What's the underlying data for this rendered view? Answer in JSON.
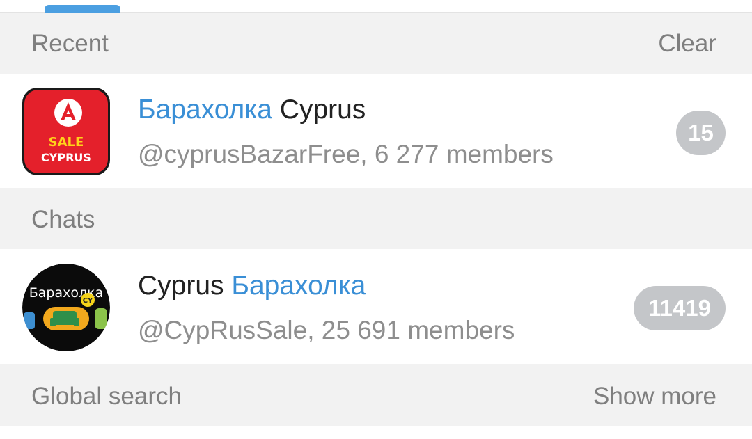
{
  "recent": {
    "title": "Recent",
    "clear_label": "Clear"
  },
  "recent_items": [
    {
      "title_highlight": "Барахолка",
      "title_rest": " Cyprus",
      "subtitle": "@cyprusBazarFree, 6 277 members",
      "badge": "15",
      "avatar_text_1": "SALE",
      "avatar_text_2": "CYPRUS"
    }
  ],
  "chats": {
    "title": "Chats"
  },
  "chat_items": [
    {
      "title_start": "Cyprus ",
      "title_highlight": "Барахолка",
      "subtitle": "@CypRusSale, 25 691 members",
      "badge": "11419",
      "avatar_text": "Барахолка",
      "avatar_tag": "CY"
    }
  ],
  "global": {
    "title": "Global search",
    "show_more_label": "Show more"
  },
  "colors": {
    "accent": "#3a8fd6",
    "section_bg": "#f2f2f2",
    "badge_bg": "#c4c6c9"
  }
}
